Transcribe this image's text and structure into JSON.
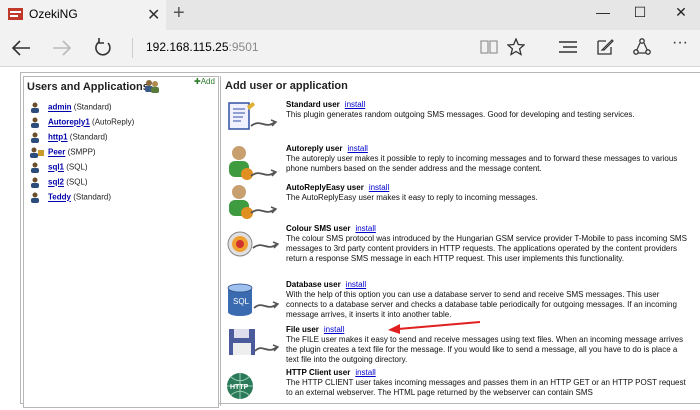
{
  "browser": {
    "tab_title": "OzekiNG",
    "tab_close": "✕",
    "new_tab": "+",
    "address_host": "192.168.115.25",
    "address_port": ":9501",
    "window_controls": {
      "minimize": "—",
      "maximize": "☐",
      "close": "✕"
    }
  },
  "left_panel": {
    "title": "Users and Applications",
    "add_label": "Add",
    "users": [
      {
        "name": "admin",
        "type": "(Standard)"
      },
      {
        "name": "Autoreply1",
        "type": "(AutoReply)"
      },
      {
        "name": "http1",
        "type": "(Standard)"
      },
      {
        "name": "Peer",
        "type": "(SMPP)"
      },
      {
        "name": "sql1",
        "type": "(SQL)"
      },
      {
        "name": "sql2",
        "type": "(SQL)"
      },
      {
        "name": "Teddy",
        "type": "(Standard)"
      }
    ]
  },
  "right_panel": {
    "title": "Add user or application",
    "install_label": "install",
    "entries": [
      {
        "name": "Standard user",
        "desc": "This plugin generates random outgoing SMS messages. Good for developing and testing services."
      },
      {
        "name": "Autoreply user",
        "desc": "The autoreply user makes it possible to reply to incoming messages and to forward these messages to various phone numbers based on the sender address and the message content."
      },
      {
        "name": "AutoReplyEasy user",
        "desc": "The AutoReplyEasy user makes it easy to reply to incoming messages."
      },
      {
        "name": "Colour SMS user",
        "desc": "The colour SMS protocol was introduced by the Hungarian GSM service provider T-Mobile to pass incoming SMS messages to 3rd party content providers in HTTP requests. The applications operated by the content providers return a response SMS message in each HTTP request. This user implements this functionality."
      },
      {
        "name": "Database user",
        "desc": "With the help of this option you can use a database server to send and receive SMS messages. This user connects to a database server and checks a database table periodically for outgoing messages. If an incoming message arrives, it inserts it into another table."
      },
      {
        "name": "File user",
        "desc": "The FILE user makes it easy to send and receive messages using text files. When an incoming message arrives the plugin creates a text file for the message. If you would like to send a message, all you have to do is place a text file into the outgoing directory."
      },
      {
        "name": "HTTP Client user",
        "desc": "The HTTP CLIENT user takes incoming messages and passes them in an HTTP GET or an HTTP POST request to an external webserver. The HTML page returned by the webserver can contain SMS"
      }
    ]
  },
  "colors": {
    "link": "#0000cc",
    "annotation_arrow": "#e02020"
  }
}
